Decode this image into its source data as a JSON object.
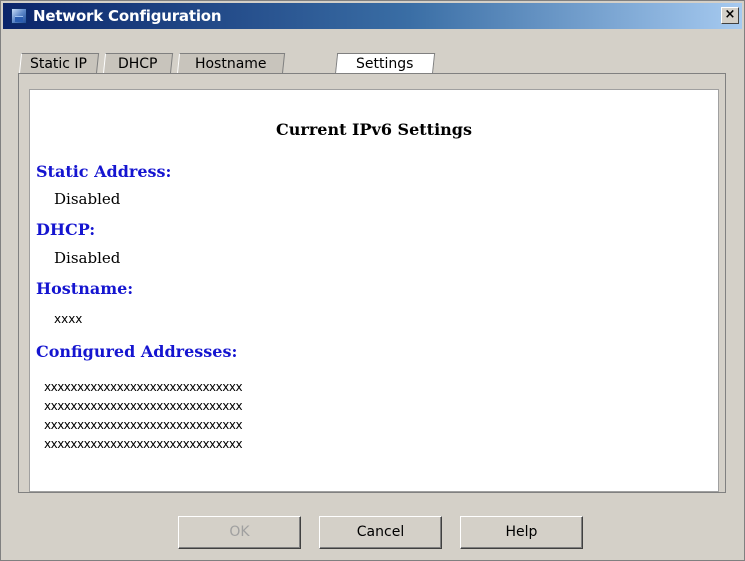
{
  "window": {
    "title": "Network Configuration",
    "close_glyph": "×"
  },
  "tabs": [
    {
      "label": "Static IP"
    },
    {
      "label": "DHCP"
    },
    {
      "label": "Hostname"
    },
    {
      "label": "Settings",
      "active": true
    }
  ],
  "settings": {
    "heading": "Current IPv6 Settings",
    "static_address_label": "Static Address:",
    "static_address_value": "Disabled",
    "dhcp_label": "DHCP:",
    "dhcp_value": "Disabled",
    "hostname_label": "Hostname:",
    "hostname_value": "xxxx",
    "configured_label": "Configured Addresses:",
    "addresses": [
      "xxxxxxxxxxxxxxxxxxxxxxxxxxxxxx",
      "xxxxxxxxxxxxxxxxxxxxxxxxxxxxxx",
      "xxxxxxxxxxxxxxxxxxxxxxxxxxxxxx",
      "xxxxxxxxxxxxxxxxxxxxxxxxxxxxxx"
    ]
  },
  "buttons": {
    "ok": "OK",
    "cancel": "Cancel",
    "help": "Help"
  },
  "colors": {
    "title_bar": "#0a246a",
    "label_blue": "#1515d0",
    "window_bg": "#d4d0c8"
  },
  "icons": {
    "app": "network-config-icon",
    "close": "close-icon"
  }
}
